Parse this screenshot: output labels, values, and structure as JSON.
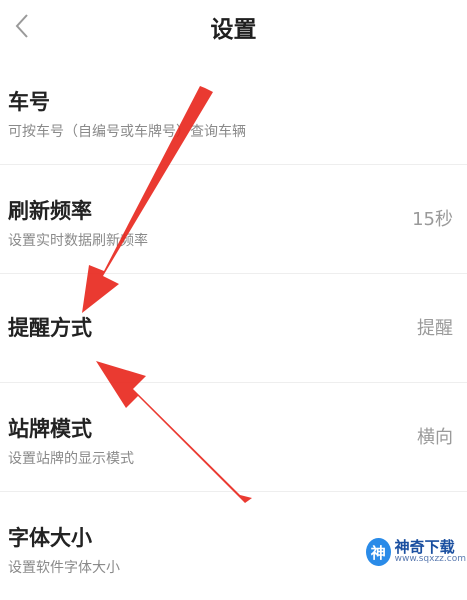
{
  "header": {
    "title": "设置",
    "back_icon": "chevron-left-icon"
  },
  "rows": [
    {
      "title": "车号",
      "subtitle": "可按车号（自编号或车牌号）查询车辆",
      "value": ""
    },
    {
      "title": "刷新频率",
      "subtitle": "设置实时数据刷新频率",
      "value": "15秒"
    },
    {
      "title": "提醒方式",
      "subtitle": "",
      "value": "提醒"
    },
    {
      "title": "站牌模式",
      "subtitle": "设置站牌的显示模式",
      "value": "横向"
    },
    {
      "title": "字体大小",
      "subtitle": "设置软件字体大小",
      "value": ""
    }
  ],
  "annotations": {
    "arrow_color": "#e8251b"
  },
  "watermark": {
    "logo_text": "神",
    "title": "神奇下载",
    "url": "www.sqxzz.com"
  }
}
